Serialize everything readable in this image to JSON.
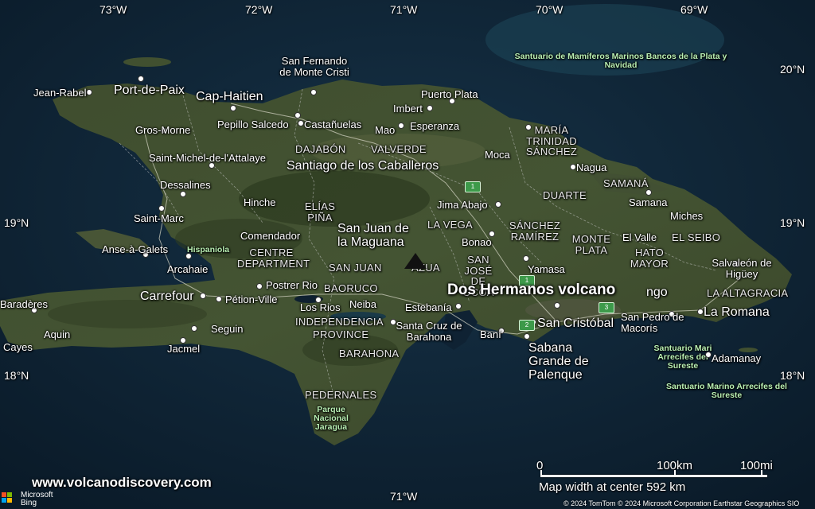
{
  "map": {
    "title": "Dos Hermanos volcano",
    "site": "www.volcanodiscovery.com",
    "provider": [
      "Microsoft",
      "Bing"
    ],
    "copyright": "© 2024 TomTom © 2024 Microsoft Corporation Earthstar Geographics SIO",
    "scale": {
      "zero": "0",
      "km": "100km",
      "mi": "100mi"
    },
    "width_note": "Map width at center 592 km",
    "longitudes": [
      "73°W",
      "72°W",
      "71°W",
      "70°W",
      "69°W",
      "71°W"
    ],
    "latitudes": [
      "20°N",
      "19°N",
      "19°N",
      "18°N",
      "18°N"
    ]
  },
  "cities": [
    "Jean-Rabel",
    "Port-de-Paix",
    "Cap-Haitien",
    "San Fernando de Monte Cristi",
    "Puerto Plata",
    "Imbert",
    "Gros-Morne",
    "Pepillo Salcedo",
    "Castañuelas",
    "Mao",
    "Esperanza",
    "Saint-Michel-de-l'Attalaye",
    "Santiago de los Caballeros",
    "Moca",
    "Nagua",
    "Dessalines",
    "Hinche",
    "Jima Abajo",
    "Samana",
    "Saint-Marc",
    "Comendador",
    "San Juan de la Maguana",
    "Bonao",
    "Miches",
    "El Valle",
    "Anse-à-Galets",
    "Arcahaie",
    "Yamasa",
    "Salvaleón de Higüey",
    "Postrer Rio",
    "Carrefour",
    "Pétion-Ville",
    "Los Rios",
    "Neiba",
    "Estebanía",
    "Baradères",
    "Aquin",
    "Seguin",
    "Santa Cruz de Barahona",
    "Baní",
    "San Cristóbal",
    "San Pedro de Macorís",
    "La Romana",
    "Cayes",
    "Jacmel",
    "Sabana Grande de Palenque",
    "Adamanay",
    "ngo"
  ],
  "regions": [
    "MARÍA TRINIDAD SÁNCHEZ",
    "DAJABÓN",
    "VALVERDE",
    "SAMANÁ",
    "DUARTE",
    "ELÍAS PIÑA",
    "LA VEGA",
    "SÁNCHEZ RAMÍREZ",
    "EL SEIBO",
    "CENTRE DEPARTMENT",
    "SAN JUAN",
    "AZUA",
    "SAN JOSÉ DE OCOA",
    "MONTE PLATA",
    "HATO MAYOR",
    "BAORUCO",
    "INDEPENDENCIA",
    "PROVINCE",
    "BARAHONA",
    "PEDERNALES",
    "LA ALTAGRACIA",
    "Hispaniola"
  ],
  "parks": [
    "Santuario de Mamíferos Marinos Bancos de la Plata y Navidad",
    "Santuario Mari Arrecifes del Sureste",
    "Santuario Marino Arrecifes del Sureste",
    "Parque Nacional Jaragua"
  ],
  "shields": [
    "1",
    "1",
    "2",
    "3"
  ],
  "colors": {
    "land": "#3d4a2c",
    "sea": "#0f2233",
    "park_label": "#b9f0b3",
    "shield": "#3d9a4a"
  }
}
